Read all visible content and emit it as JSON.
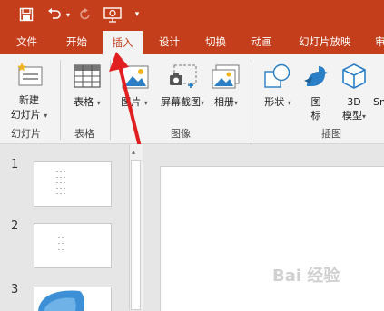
{
  "colors": {
    "accent": "#c43e1c",
    "ribbon_bg": "#f3f3f3",
    "arrow": "#e02020"
  },
  "qat": {
    "save": "save-icon",
    "undo": "undo-icon",
    "redo": "redo-icon",
    "present": "present-from-start-icon",
    "customize": "customize-qat-icon"
  },
  "tabs": [
    "文件",
    "开始",
    "插入",
    "设计",
    "切换",
    "动画",
    "幻灯片放映",
    "审"
  ],
  "active_tab": "插入",
  "ribbon": {
    "new_slide": {
      "line1": "新建",
      "line2": "幻灯片",
      "caret": "▾"
    },
    "table": {
      "label": "表格",
      "caret": "▾"
    },
    "picture": {
      "label": "图片",
      "caret": "▾"
    },
    "screenshot": {
      "label": "屏幕截图",
      "caret": "▾"
    },
    "album": {
      "label": "相册",
      "caret": "▾"
    },
    "shapes": {
      "label": "形状",
      "caret": "▾"
    },
    "icons": {
      "line1": "图",
      "line2": "标"
    },
    "model3d": {
      "line1": "3D",
      "line2": "模型",
      "caret": "▾"
    },
    "smartart": {
      "label": "Sn"
    },
    "groups": {
      "slides": "幻灯片",
      "tables": "表格",
      "images": "图像",
      "illustrations": "插图"
    }
  },
  "slides": [
    {
      "number": "1"
    },
    {
      "number": "2"
    },
    {
      "number": "3"
    }
  ],
  "watermark": "Bai 经验"
}
